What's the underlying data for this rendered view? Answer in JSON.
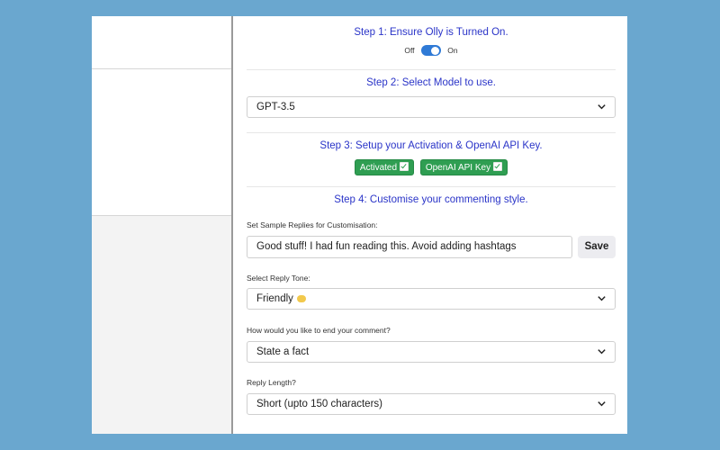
{
  "step1": {
    "title": "Step 1: Ensure Olly is Turned On.",
    "toggle_off_label": "Off",
    "toggle_on_label": "On",
    "toggle_state": "on"
  },
  "step2": {
    "title": "Step 2: Select Model to use.",
    "model_value": "GPT-3.5"
  },
  "step3": {
    "title": "Step 3: Setup your Activation & OpenAI API Key.",
    "badges": [
      {
        "label": "Activated"
      },
      {
        "label": "OpenAI API Key"
      }
    ]
  },
  "step4": {
    "title": "Step 4: Customise your commenting style.",
    "sample_label": "Set Sample Replies for Customisation:",
    "sample_value": "Good stuff! I had fun reading this. Avoid adding hashtags",
    "save_label": "Save",
    "tone_label": "Select Reply Tone:",
    "tone_value": "Friendly",
    "tone_icon": "handshake-emoji",
    "ending_label": "How would you like to end your comment?",
    "ending_value": "State a fact",
    "length_label": "Reply Length?",
    "length_value": "Short (upto 150 characters)"
  },
  "colors": {
    "background": "#6aa7cf",
    "step_title": "#2a34c8",
    "toggle_on": "#2f7ad6",
    "badge_green": "#2f9e52"
  }
}
